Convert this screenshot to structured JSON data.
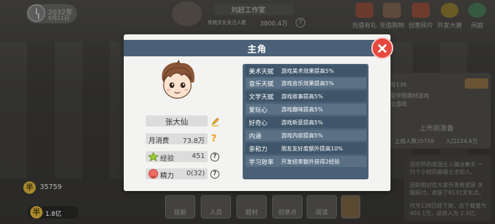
{
  "topbar": {
    "date_year": "2032年",
    "date_md": "9月11日",
    "studio_name": "刘赶工作室",
    "followers_label": "传统文化关注人数",
    "followers_value": "3800.4万",
    "actions": [
      {
        "label": "充值有礼",
        "icon": "gift-box-icon"
      },
      {
        "label": "充值购物",
        "icon": "shopping-icon"
      },
      {
        "label": "创意碎片",
        "icon": "gift-icon"
      },
      {
        "label": "开发大赛",
        "icon": "trophy-icon"
      },
      {
        "label": "闲庭",
        "icon": "tree-icon"
      }
    ]
  },
  "currency": {
    "coin_symbol": "半",
    "coins": "35759",
    "yi_symbol": "半",
    "yi_value": "1.8亿"
  },
  "bottom_menu": [
    "技能",
    "人员",
    "题材",
    "创意点",
    "阅读"
  ],
  "background_panel": {
    "title": "代号139",
    "line1": "类型中国题材游戏",
    "line2": "独立游戏",
    "subtitle": "上市前准备",
    "stats": "上线人数35759",
    "rate": "入口224.6万"
  },
  "log_lines": [
    "因乐怀的英国士人偏冰春天 一只个小时的高级士才的人。",
    "因职相对在大家开发希望是 关报探讨，收获了8131文化点。",
    "代号138已经下架，总下载量为 403.1万，总收入为 2.5亿。"
  ],
  "modal": {
    "title": "主角",
    "character": {
      "name": "张大仙",
      "monthly_spend_label": "月消费",
      "monthly_spend_value": "73.8万",
      "exp_label": "经验",
      "exp_value": "451",
      "energy_label": "精力",
      "energy_value": "0(32)"
    },
    "talents": [
      {
        "name": "美术天赋",
        "effect": "游戏美术效果提高5%"
      },
      {
        "name": "音乐天赋",
        "effect": "游戏音乐效果提高5%"
      },
      {
        "name": "文学天赋",
        "effect": "游戏故事提高5%"
      },
      {
        "name": "爱玩心",
        "effect": "游戏趣味提高5%"
      },
      {
        "name": "好奇心",
        "effect": "游戏新意提高5%"
      },
      {
        "name": "内涵",
        "effect": "游戏内容提高5%"
      },
      {
        "name": "亲和力",
        "effect": "朋友友好度额外提高10%"
      },
      {
        "name": "学习效率",
        "effect": "开发结束额外获得2经验"
      }
    ]
  },
  "colors": {
    "header_blue": "#4a6076",
    "close_red": "#e6483e",
    "accent_orange": "#f0a020"
  }
}
